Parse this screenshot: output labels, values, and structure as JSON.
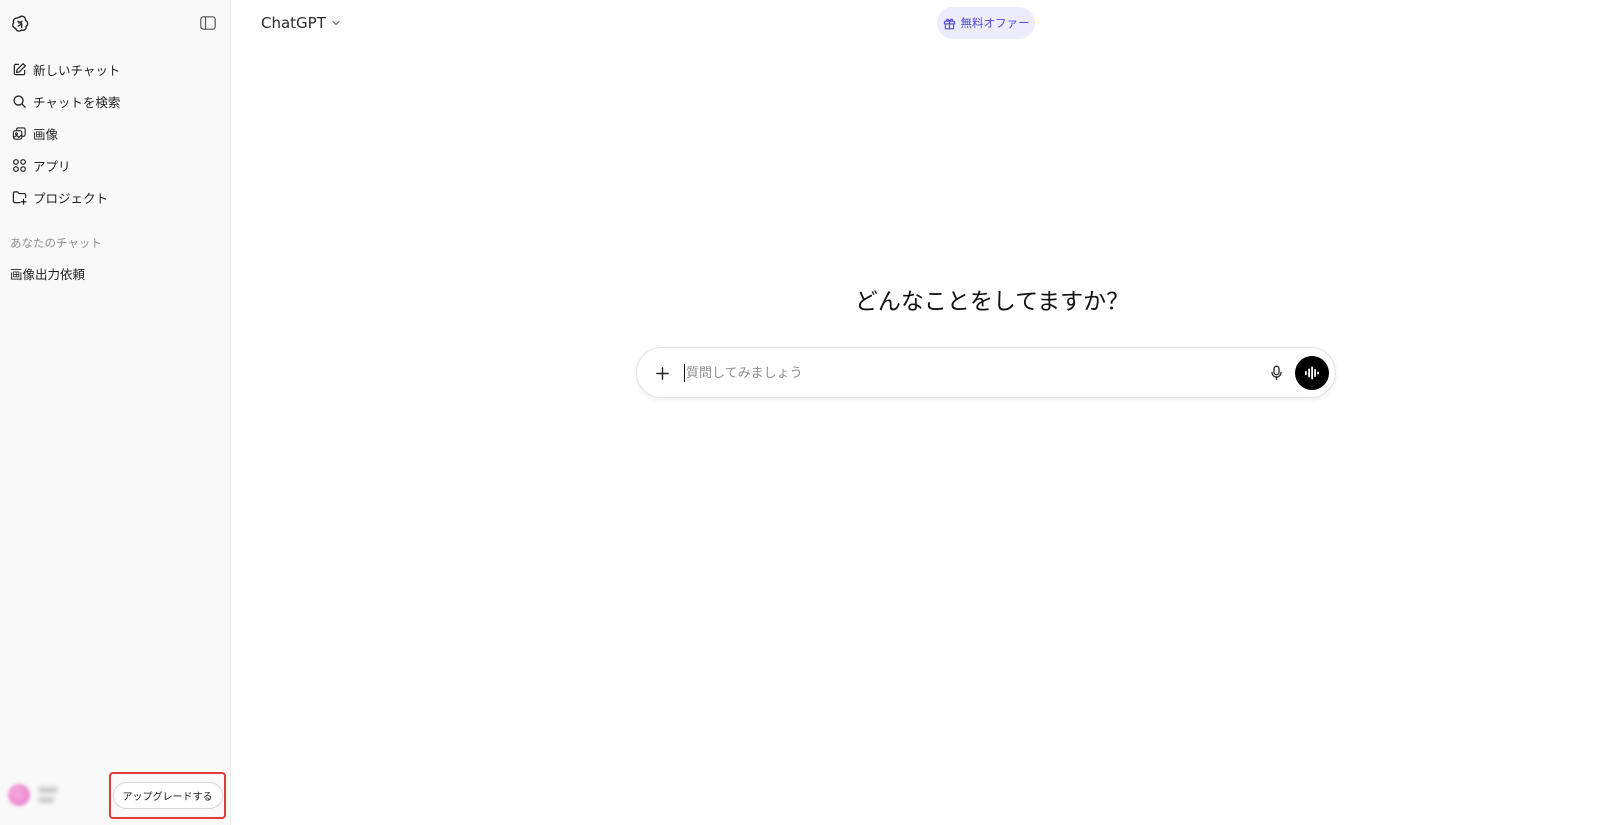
{
  "sidebar": {
    "logo_icon": "openai-logo-icon",
    "toggle_icon": "sidebar-toggle-icon",
    "nav": [
      {
        "label": "新しいチャット",
        "icon": "edit-icon"
      },
      {
        "label": "チャットを検索",
        "icon": "search-icon"
      },
      {
        "label": "画像",
        "icon": "images-icon"
      },
      {
        "label": "アプリ",
        "icon": "apps-icon"
      },
      {
        "label": "プロジェクト",
        "icon": "folder-plus-icon"
      }
    ],
    "section_label": "あなたのチャット",
    "history": [
      {
        "label": "画像出力依頼"
      }
    ],
    "upgrade_label": "アップグレードする",
    "highlight_color": "#e23b3b"
  },
  "header": {
    "model_label": "ChatGPT",
    "offer_label": "無料オファー",
    "offer_icon": "gift-icon",
    "offer_color": "#5149d8"
  },
  "main": {
    "headline": "どんなことをしてますか？",
    "composer": {
      "placeholder": "質問してみましょう",
      "value": "",
      "plus_icon": "plus-icon",
      "mic_icon": "microphone-icon",
      "voice_icon": "voice-mode-icon"
    }
  }
}
